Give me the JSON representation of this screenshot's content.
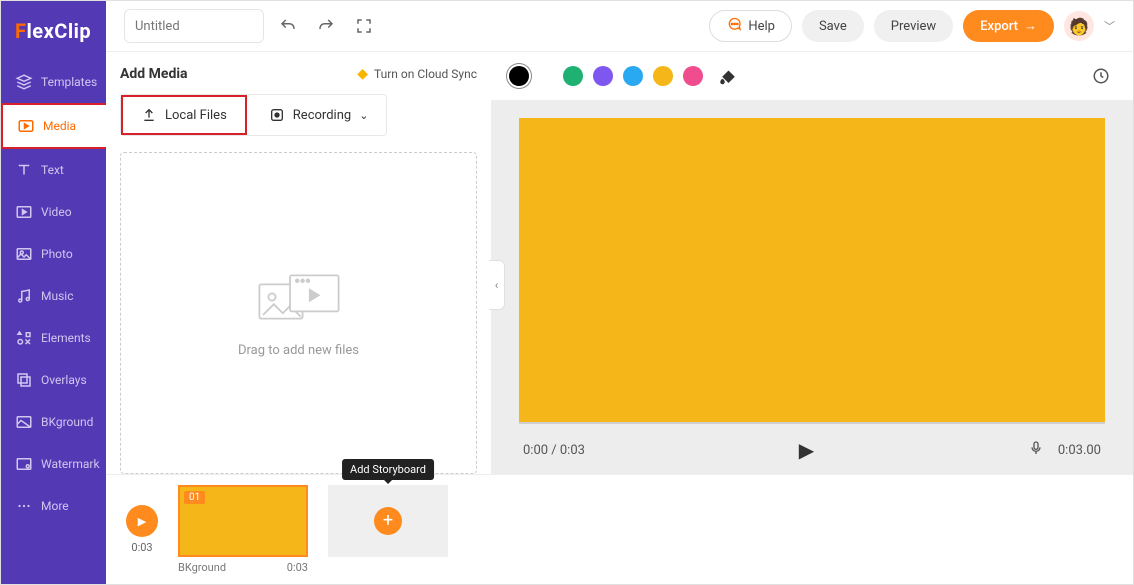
{
  "brand": {
    "pre": "F",
    "rest": "lexClip"
  },
  "sidebar": {
    "items": [
      {
        "label": "Templates"
      },
      {
        "label": "Media"
      },
      {
        "label": "Text"
      },
      {
        "label": "Video"
      },
      {
        "label": "Photo"
      },
      {
        "label": "Music"
      },
      {
        "label": "Elements"
      },
      {
        "label": "Overlays"
      },
      {
        "label": "BKground"
      },
      {
        "label": "Watermark"
      },
      {
        "label": "More"
      }
    ]
  },
  "header": {
    "title_placeholder": "Untitled",
    "help": "Help",
    "save": "Save",
    "preview": "Preview",
    "export": "Export"
  },
  "media_panel": {
    "title": "Add Media",
    "cloud_sync": "Turn on Cloud Sync",
    "local_files": "Local Files",
    "recording": "Recording",
    "drop_hint": "Drag to add new files"
  },
  "colors": {
    "swatches": [
      "#000000",
      "#1fb171",
      "#7e57f0",
      "#2aa9f3",
      "#f4b619",
      "#f04d8e"
    ]
  },
  "player": {
    "time": "0:00 / 0:03",
    "duration": "0:03.00"
  },
  "timeline": {
    "play_time": "0:03",
    "clip": {
      "index": "01",
      "name": "BKground",
      "dur": "0:03"
    },
    "add_tooltip": "Add Storyboard"
  }
}
